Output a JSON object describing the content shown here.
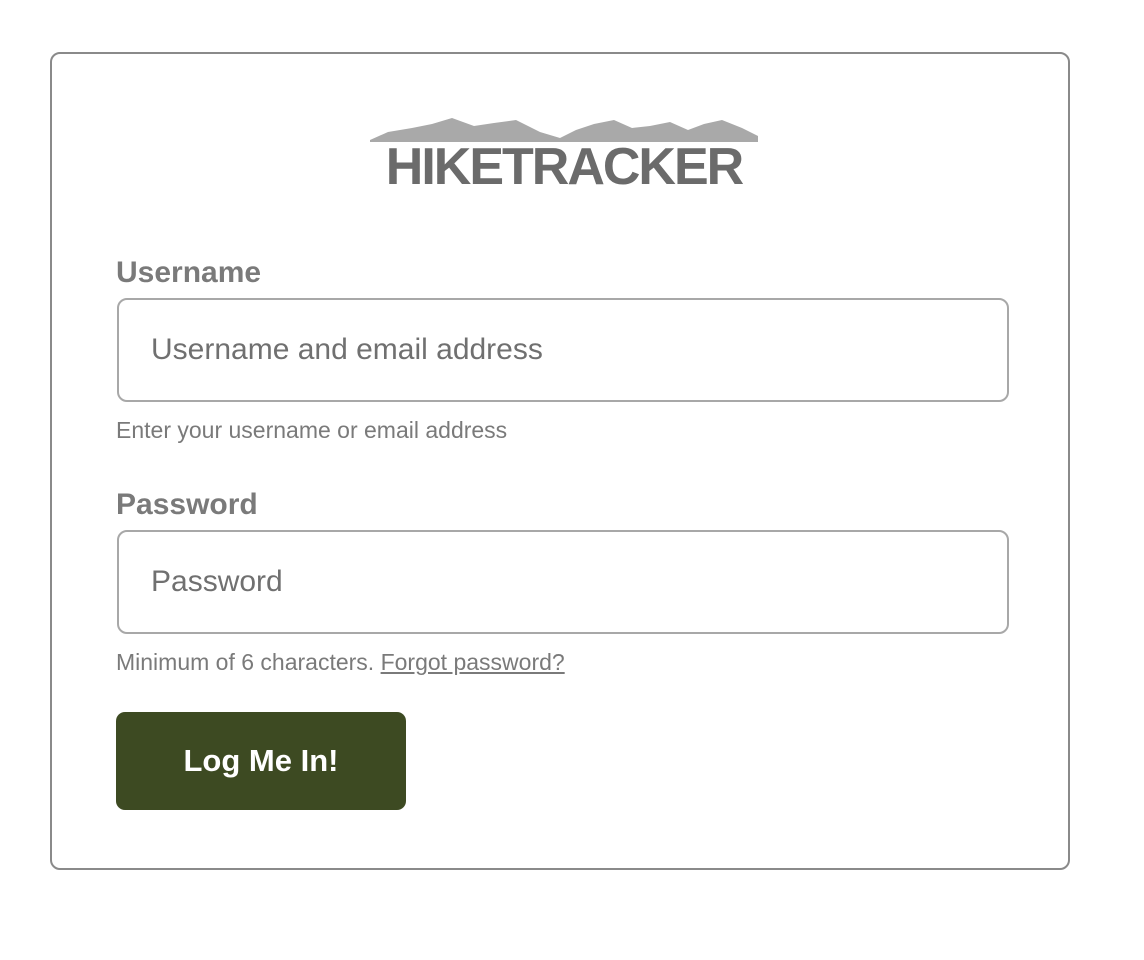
{
  "logo": {
    "text": "HIKETRACKER",
    "color": "#6b6b6b",
    "mountain_color": "#a9a9a9"
  },
  "username": {
    "label": "Username",
    "placeholder": "Username and email address",
    "value": "",
    "help": "Enter your username or email address"
  },
  "password": {
    "label": "Password",
    "placeholder": "Password",
    "value": "",
    "help": "Minimum of 6 characters.",
    "forgot_link": "Forgot password?"
  },
  "submit": {
    "label": "Log Me In!",
    "color": "#3d4a22"
  }
}
